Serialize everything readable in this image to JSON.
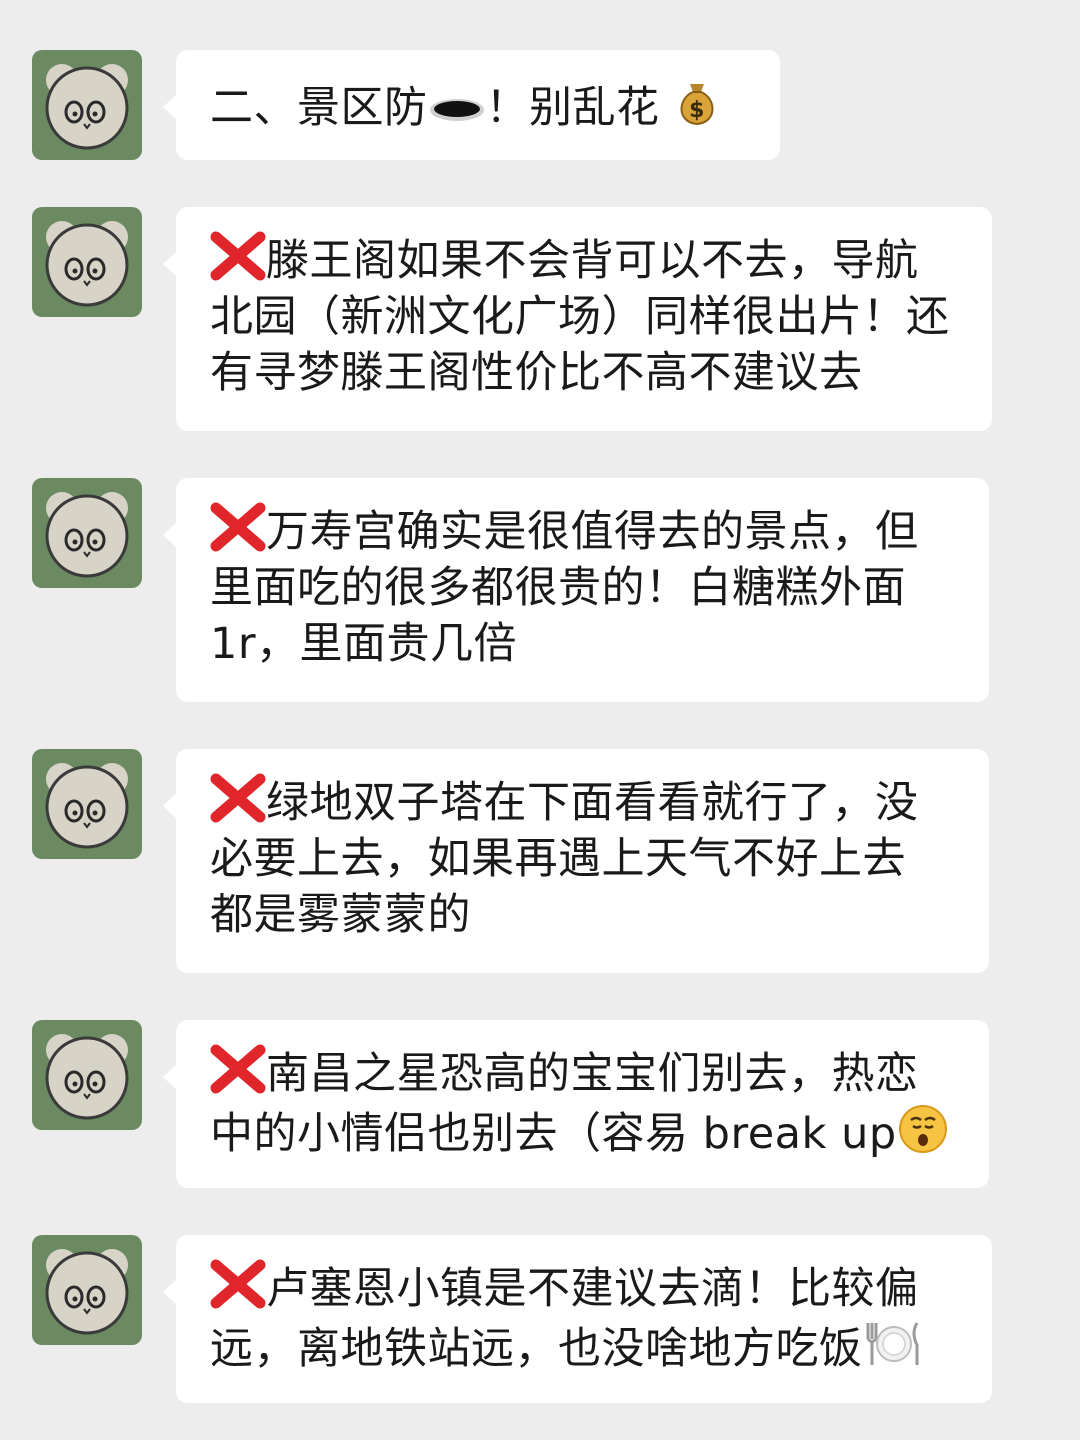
{
  "messages": [
    {
      "lines": [
        "二、景区防",
        "！别乱花"
      ],
      "icons": [
        "hole-icon",
        "money-bag-icon"
      ]
    },
    {
      "lines": [
        "滕王阁如果不会背可以不去，导航",
        "北园（新洲文化广场）同样很出片！还",
        "有寻梦滕王阁性价比不高不建议去"
      ],
      "icons": [
        "cross-mark-icon"
      ]
    },
    {
      "lines": [
        "万寿宫确实是很值得去的景点，但",
        "里面吃的很多都很贵的！白糖糕外面",
        "1r，里面贵几倍"
      ],
      "icons": [
        "cross-mark-icon"
      ]
    },
    {
      "lines": [
        "绿地双子塔在下面看看就行了，没",
        "必要上去，如果再遇上天气不好上去",
        "都是雾蒙蒙的"
      ],
      "icons": [
        "cross-mark-icon"
      ]
    },
    {
      "lines": [
        "南昌之星恐高的宝宝们别去，热恋",
        "中的小情侣也别去（容易 break up"
      ],
      "icons": [
        "cross-mark-icon",
        "kissing-face-icon"
      ]
    },
    {
      "lines": [
        "卢塞恩小镇是不建议去滴！比较偏",
        "远，离地铁站远，也没啥地方吃饭"
      ],
      "icons": [
        "cross-mark-icon",
        "plate-cutlery-icon"
      ]
    }
  ],
  "colors": {
    "background": "#ededed",
    "bubble": "#ffffff",
    "text": "#1a1a1a",
    "avatar_bg": "#6b8a62",
    "cross": "#e0262b"
  }
}
